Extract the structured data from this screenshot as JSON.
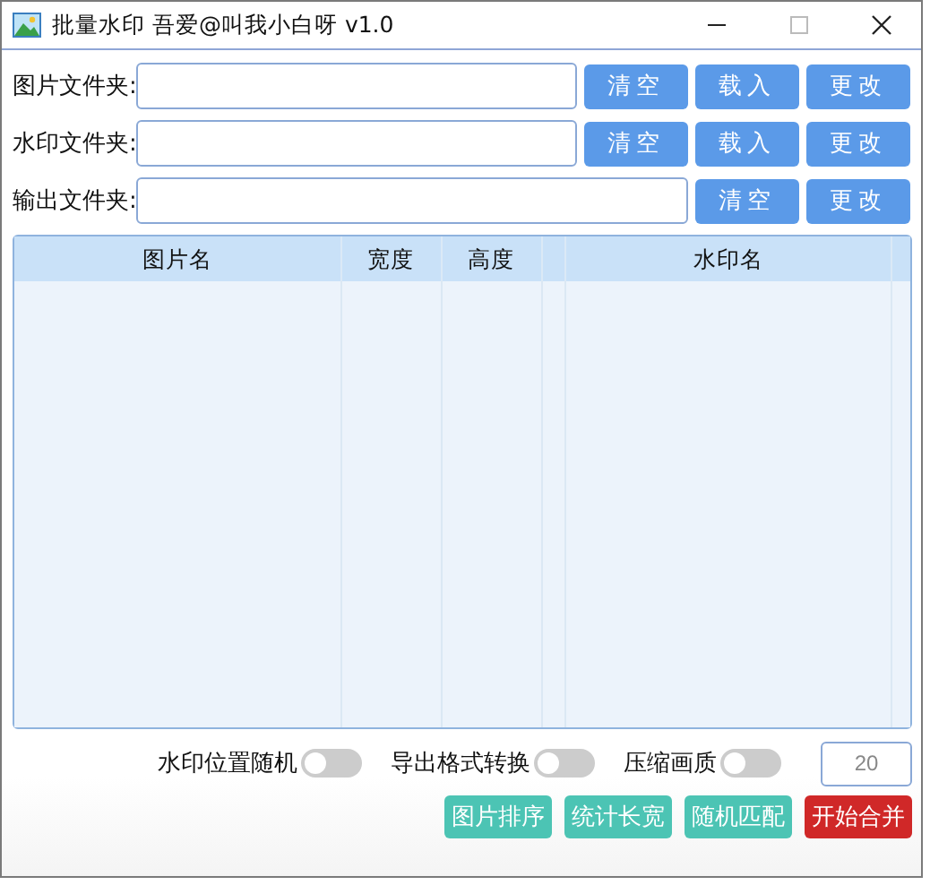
{
  "window": {
    "title": "批量水印 吾爱@叫我小白呀 v1.0"
  },
  "folders": [
    {
      "label": "图片文件夹:",
      "buttons": [
        "清空",
        "载入",
        "更改"
      ]
    },
    {
      "label": "水印文件夹:",
      "buttons": [
        "清空",
        "载入",
        "更改"
      ]
    },
    {
      "label": "输出文件夹:",
      "buttons": [
        "清空",
        "更改"
      ]
    }
  ],
  "table": {
    "columns": [
      {
        "label": "图片名"
      },
      {
        "label": "宽度"
      },
      {
        "label": "高度"
      },
      {
        "label": "水印名"
      }
    ]
  },
  "options": [
    {
      "label": "水印位置随机",
      "on": false
    },
    {
      "label": "导出格式转换",
      "on": false
    },
    {
      "label": "压缩画质",
      "on": false
    }
  ],
  "quality": {
    "value": "20"
  },
  "actions": [
    {
      "label": "图片排序",
      "kind": "normal"
    },
    {
      "label": "统计长宽",
      "kind": "normal"
    },
    {
      "label": "随机匹配",
      "kind": "normal"
    },
    {
      "label": "开始合并",
      "kind": "danger"
    }
  ]
}
